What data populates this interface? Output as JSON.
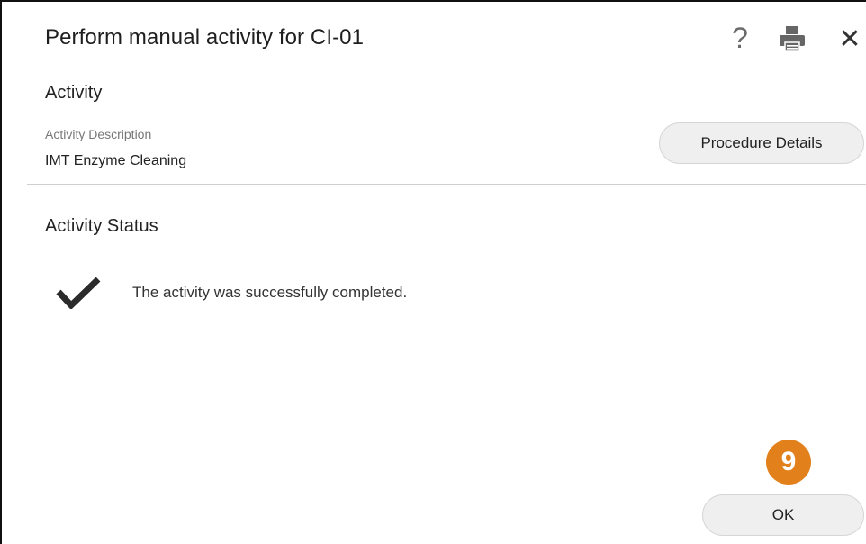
{
  "dialog": {
    "title": "Perform manual activity for CI-01",
    "help_glyph": "?",
    "close_glyph": "✕",
    "icons": [
      "help-icon",
      "print-icon",
      "close-icon"
    ]
  },
  "activity": {
    "heading": "Activity",
    "description_label": "Activity Description",
    "description_value": "IMT Enzyme Cleaning",
    "procedure_button": "Procedure Details"
  },
  "status": {
    "heading": "Activity Status",
    "message": "The activity was successfully completed.",
    "icon": "checkmark-icon"
  },
  "step_badge": {
    "number": "9",
    "color": "#e2801c"
  },
  "footer": {
    "ok_label": "OK"
  }
}
